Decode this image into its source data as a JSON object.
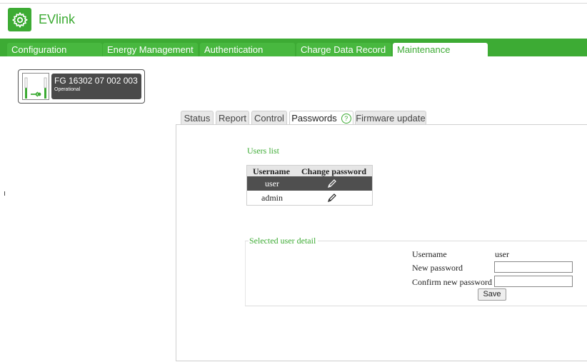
{
  "app": {
    "title": "EVlink",
    "logo_icon": "gear-icon",
    "brand_color": "#3dab34"
  },
  "nav": {
    "tabs": [
      {
        "label": "Configuration"
      },
      {
        "label": "Energy Management"
      },
      {
        "label": "Authentication"
      },
      {
        "label": "Charge Data Record"
      },
      {
        "label": "Maintenance",
        "active": true
      }
    ]
  },
  "charger": {
    "name": "FG 16302 07 002 003",
    "status": "Operational",
    "icon": "ev-charger-icon"
  },
  "subtabs": {
    "tabs": [
      {
        "label": "Status"
      },
      {
        "label": "Report"
      },
      {
        "label": "Control"
      },
      {
        "label": "Passwords",
        "active": true
      },
      {
        "label": "Firmware update"
      }
    ],
    "help_icon": "?"
  },
  "users_list": {
    "title": "Users list",
    "columns": [
      "Username",
      "Change password"
    ],
    "rows": [
      {
        "username": "user",
        "selected": true,
        "action_icon": "pencil-icon"
      },
      {
        "username": "admin",
        "selected": false,
        "action_icon": "pencil-icon"
      }
    ]
  },
  "detail": {
    "title": "Selected user detail",
    "username_label": "Username",
    "username_value": "user",
    "new_password_label": "New password",
    "new_password_value": "",
    "confirm_password_label": "Confirm new password",
    "confirm_password_value": "",
    "save_label": "Save"
  }
}
